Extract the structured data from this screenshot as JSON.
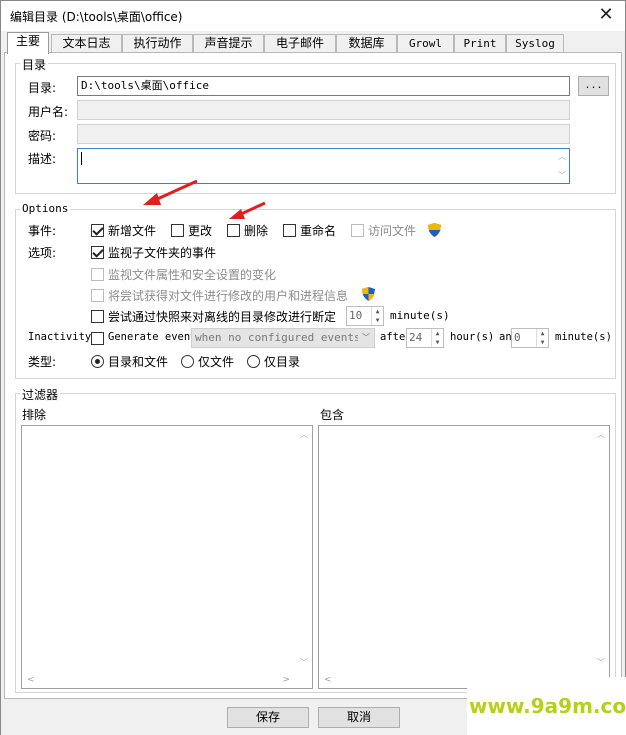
{
  "window": {
    "title": "编辑目录 (D:\\tools\\桌面\\office)",
    "close_glyph": "✕"
  },
  "tabs": [
    "主要",
    "文本日志",
    "执行动作",
    "声音提示",
    "电子邮件",
    "数据库",
    "Growl",
    "Print",
    "Syslog"
  ],
  "directory_group": {
    "legend": "目录",
    "dir_label": "目录:",
    "dir_value": "D:\\tools\\桌面\\office",
    "browse_label": "...",
    "user_label": "用户名:",
    "user_value": "",
    "password_label": "密码:",
    "password_value": "",
    "desc_label": "描述:",
    "desc_value": ""
  },
  "options_group": {
    "legend": "Options",
    "events_label": "事件:",
    "events": [
      {
        "label": "新增文件",
        "checked": true,
        "enabled": true
      },
      {
        "label": "更改",
        "checked": false,
        "enabled": true
      },
      {
        "label": "删除",
        "checked": false,
        "enabled": true
      },
      {
        "label": "重命名",
        "checked": false,
        "enabled": true
      },
      {
        "label": "访问文件",
        "checked": false,
        "enabled": false
      }
    ],
    "options_label": "选项:",
    "monitor_subfolders": "监视子文件夹的事件",
    "monitor_attributes": "监视文件属性和安全设置的变化",
    "try_get_user": "将尝试获得对文件进行修改的用户和进程信息",
    "snapshot_label": "尝试通过快照来对离线的目录修改进行断定",
    "snapshot_value": "10",
    "snapshot_unit": "minute(s)",
    "inactivity_label": "Inactivity",
    "generate_label": "Generate event",
    "generate_combo": "when no configured events occur",
    "after_label": "after",
    "hours_value": "24",
    "hours_unit": "hour(s)",
    "and_label": "an",
    "minutes_value": "0",
    "minutes_unit": "minute(s)",
    "type_label": "类型:",
    "types": [
      {
        "label": "目录和文件",
        "checked": true
      },
      {
        "label": "仅文件",
        "checked": false
      },
      {
        "label": "仅目录",
        "checked": false
      }
    ]
  },
  "filter_group": {
    "legend": "过滤器",
    "exclude_label": "排除",
    "include_label": "包含"
  },
  "buttons": {
    "save": "保存",
    "cancel": "取消"
  },
  "watermark": "www.9a9m.com",
  "colors": {
    "arrow": "#e02020",
    "watermark": "#b7cf1a",
    "shield_blue": "#1f5fbf",
    "shield_yellow": "#f2b705"
  }
}
